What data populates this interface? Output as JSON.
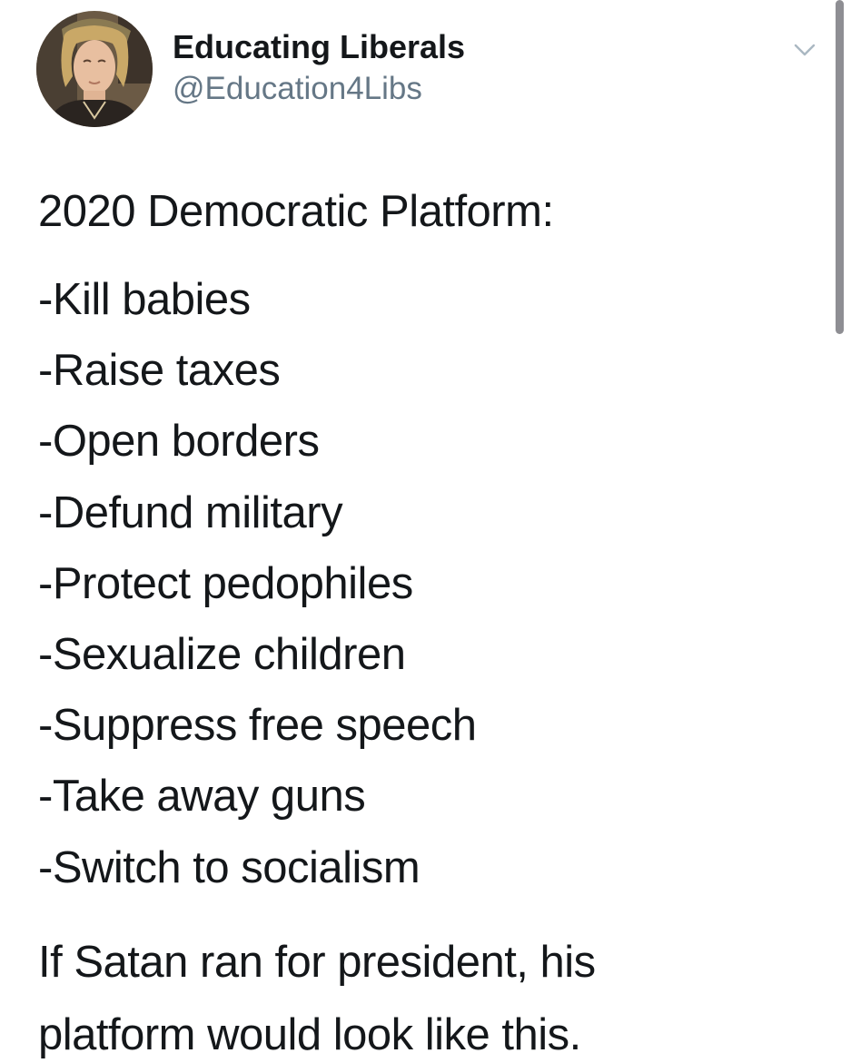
{
  "author": {
    "display_name": "Educating Liberals",
    "handle": "@Education4Libs",
    "avatar_icon": "profile-photo"
  },
  "menu": {
    "icon": "chevron-down-icon"
  },
  "tweet": {
    "heading": "2020 Democratic Platform:",
    "items": [
      "-Kill babies",
      "-Raise taxes",
      "-Open borders",
      "-Defund military",
      "-Protect pedophiles",
      "-Sexualize children",
      "-Suppress free speech",
      "-Take away guns",
      "-Switch to socialism"
    ],
    "closing_lines": [
      "If Satan ran for president, his",
      "platform would look like this."
    ]
  },
  "colors": {
    "name": "#14171a",
    "handle": "#657786",
    "text": "#14171a",
    "scrollbar": "#8e8e93",
    "chevron": "#aab8c2"
  }
}
